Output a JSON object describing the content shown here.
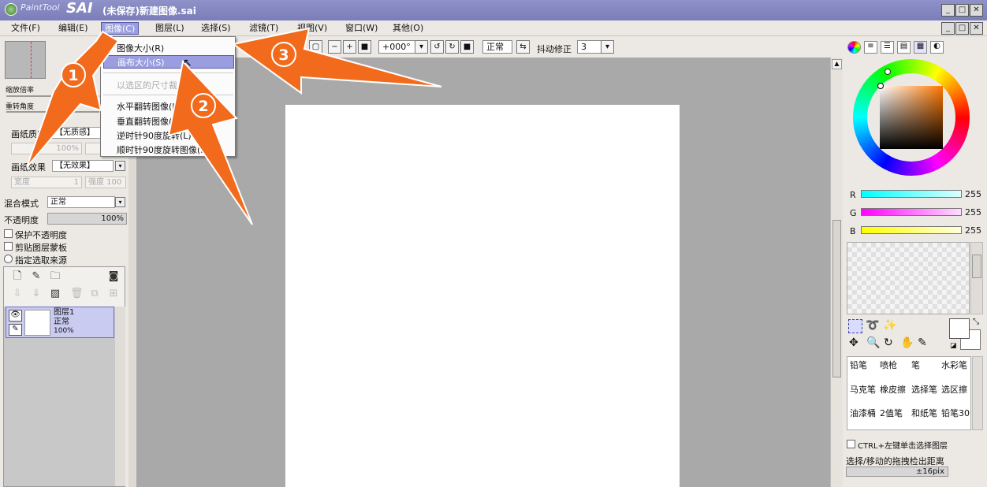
{
  "title_bar": {
    "app_logo_small": "PaintTool",
    "app_logo_big": "SAI",
    "document_title": "(未保存)新建图像.sai"
  },
  "menu_bar": {
    "items": [
      "文件(F)",
      "编辑(E)",
      "图像(C)",
      "图层(L)",
      "选择(S)",
      "滤镜(T)",
      "视图(V)",
      "窗口(W)",
      "其他(O)"
    ],
    "active": "图像(C)"
  },
  "image_menu": {
    "items": [
      "图像大小(R)",
      "画布大小(S)",
      "以选区的尺寸裁剪",
      "水平翻转图像(H)",
      "垂直翻转图像(V)",
      "逆时针90度旋转(L)",
      "顺时针90度旋转图像(R)"
    ],
    "highlighted": "画布大小(S)"
  },
  "toolbar": {
    "angle_value": "+000°",
    "blend_mode": "正常",
    "stabilizer_label": "抖动修正",
    "stabilizer_value": "3"
  },
  "navigator": {
    "zoom_label": "缩放倍率",
    "rotate_label": "重转角度"
  },
  "paper_settings": {
    "texture_label": "画纸质感",
    "texture_value": "【无质感】",
    "texture_scale": "100%",
    "effect_label": "画纸效果",
    "effect_value": "【无效果】",
    "effect_width_label": "宽度",
    "effect_width_value": "1",
    "effect_strength": "强度 100"
  },
  "layer_settings": {
    "blend_label": "混合模式",
    "blend_value": "正常",
    "opacity_label": "不透明度",
    "opacity_value": "100%",
    "preserve_opacity": "保护不透明度",
    "clip_group": "剪贴图层蒙板",
    "selection_source": "指定选取来源"
  },
  "layers": [
    {
      "name": "图层1",
      "mode": "正常",
      "opacity": "100%"
    }
  ],
  "colors": {
    "r_label": "R",
    "r_value": "255",
    "g_label": "G",
    "g_value": "255",
    "b_label": "B",
    "b_value": "255"
  },
  "tools": {
    "brushes": [
      "铅笔",
      "喷枪",
      "笔",
      "水彩笔",
      "马克笔",
      "橡皮擦",
      "选择笔",
      "选区擦",
      "油漆桶",
      "2值笔",
      "和纸笔",
      "铅笔30"
    ]
  },
  "options": {
    "ctrl_select_layer": "CTRL+左键单击选择图层",
    "drag_threshold_label": "选择/移动的拖拽检出距离",
    "drag_threshold_value": "±16pix"
  },
  "annotations": {
    "step1": "1",
    "step2": "2",
    "step3": "3"
  },
  "accent_colors": {
    "menu_highlight": "#9a9ee0",
    "title_bar": "#8f92c8",
    "arrow_orange": "#f26b1d"
  }
}
